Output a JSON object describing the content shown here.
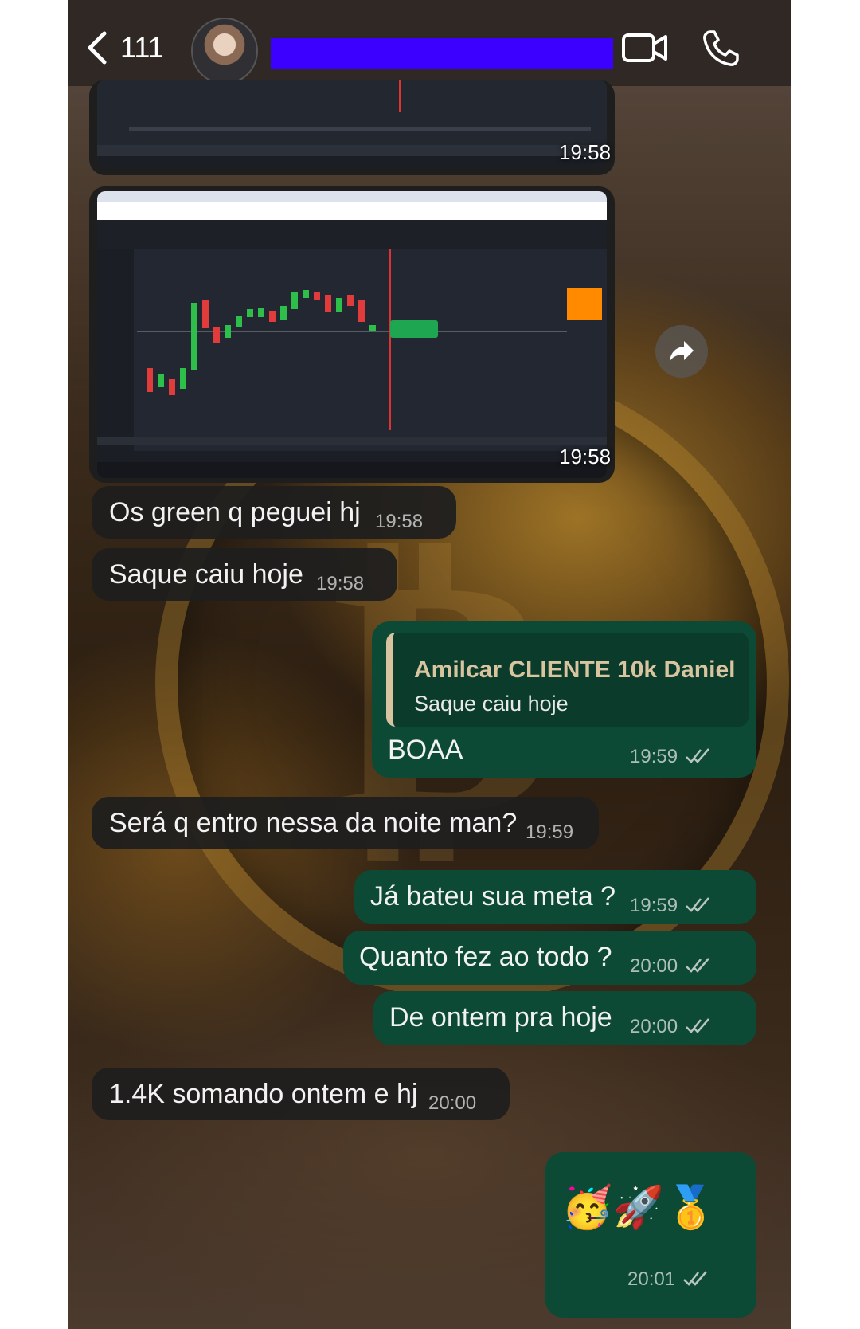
{
  "header": {
    "back_count": "111",
    "icons": [
      "chevron-left-icon",
      "video-camera-icon",
      "phone-icon"
    ]
  },
  "images": [
    {
      "time": "19:58"
    },
    {
      "time": "19:58"
    }
  ],
  "messages": [
    {
      "text": "Os green q peguei hj",
      "time": "19:58",
      "direction": "incoming"
    },
    {
      "text": "Saque caiu hoje",
      "time": "19:58",
      "direction": "incoming"
    },
    {
      "text": "BOAA",
      "time": "19:59",
      "direction": "outgoing",
      "quote": {
        "author": "Amilcar CLIENTE 10k Daniel",
        "text": "Saque caiu hoje"
      }
    },
    {
      "text": "Será q entro nessa da noite man?",
      "time": "19:59",
      "direction": "incoming"
    },
    {
      "text": "Já bateu sua meta ?",
      "time": "19:59",
      "direction": "outgoing"
    },
    {
      "text": "Quanto fez ao todo ?",
      "time": "20:00",
      "direction": "outgoing"
    },
    {
      "text": "De ontem pra hoje",
      "time": "20:00",
      "direction": "outgoing"
    },
    {
      "text": "1.4K somando ontem e hj",
      "time": "20:00",
      "direction": "incoming"
    },
    {
      "text": "🥳🚀🥇",
      "time": "20:01",
      "direction": "outgoing"
    }
  ],
  "emojis": [
    "🥳",
    "🚀",
    "🥇"
  ],
  "colors": {
    "incoming_bubble": "#1e1e1e",
    "outgoing_bubble": "#0d4a36",
    "quote_accent": "#d7c3a0",
    "redaction": "#3b00ff"
  }
}
